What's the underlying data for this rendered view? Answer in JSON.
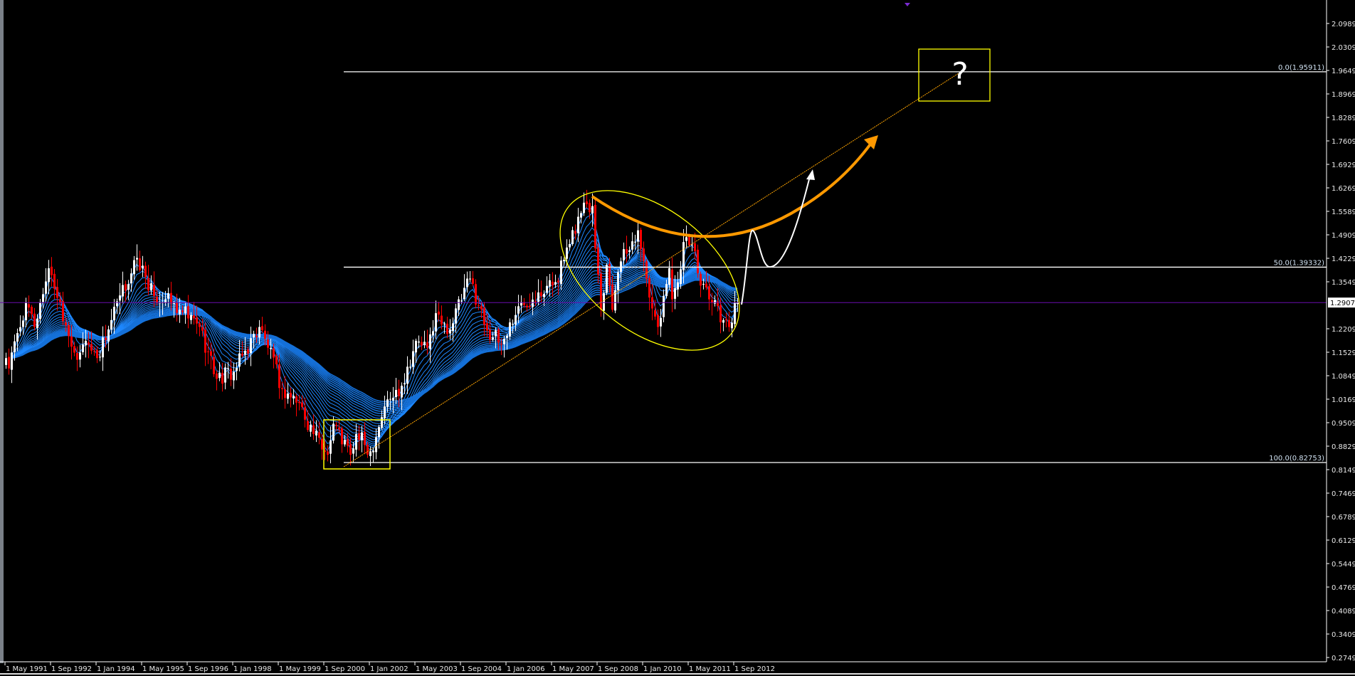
{
  "chart_data": {
    "type": "candlestick",
    "timeframe": "monthly",
    "colors": {
      "background": "#000000",
      "bull": "#ffffff",
      "bear": "#ff0000",
      "ribbon": "#1e88ff",
      "current_price_line": "#6a0dad",
      "fib": "#ffffff",
      "box": "#ffff00",
      "arc": "#ff9900",
      "trendline": "#ffa500"
    },
    "y_range": [
      0.2749,
      2.0989
    ],
    "y_ticks": [
      "2.09890",
      "2.03090",
      "1.96490",
      "1.89690",
      "1.82890",
      "1.76090",
      "1.69290",
      "1.62690",
      "1.55890",
      "1.49090",
      "1.42290",
      "1.35490",
      "",
      "1.22090",
      "1.15290",
      "1.08490",
      "1.01690",
      "0.95090",
      "0.88290",
      "0.81490",
      "0.74690",
      "0.67890",
      "0.61290",
      "0.54490",
      "0.47690",
      "0.40890",
      "0.34090",
      "0.27490"
    ],
    "x_ticks": [
      "1 May 1991",
      "1 Sep 1992",
      "1 Jan 1994",
      "1 May 1995",
      "1 Sep 1996",
      "1 Jan 1998",
      "1 May 1999",
      "1 Sep 2000",
      "1 Jan 2002",
      "1 May 2003",
      "1 Sep 2004",
      "1 Jan 2006",
      "1 May 2007",
      "1 Sep 2008",
      "1 Jan 2010",
      "1 May 2011",
      "1 Sep 2012"
    ],
    "current_price": "1.29074",
    "start_month": "1991-05",
    "bars": 258,
    "close_anchors": [
      [
        "1991-05",
        1.13
      ],
      [
        "1991-06",
        1.1
      ],
      [
        "1991-12",
        1.29
      ],
      [
        "1992-03",
        1.22
      ],
      [
        "1992-08",
        1.39
      ],
      [
        "1992-09",
        1.37
      ],
      [
        "1993-06",
        1.125
      ],
      [
        "1993-09",
        1.18
      ],
      [
        "1994-01",
        1.13
      ],
      [
        "1994-06",
        1.24
      ],
      [
        "1995-03",
        1.42
      ],
      [
        "1995-09",
        1.31
      ],
      [
        "1996-01",
        1.3
      ],
      [
        "1996-06",
        1.27
      ],
      [
        "1997-01",
        1.22
      ],
      [
        "1997-07",
        1.07
      ],
      [
        "1998-01",
        1.09
      ],
      [
        "1998-10",
        1.22
      ],
      [
        "1999-01",
        1.16
      ],
      [
        "1999-06",
        1.04
      ],
      [
        "1999-12",
        1.0
      ],
      [
        "2000-05",
        0.91
      ],
      [
        "2000-10",
        0.85
      ],
      [
        "2000-12",
        0.94
      ],
      [
        "2001-06",
        0.85
      ],
      [
        "2001-08",
        0.91
      ],
      [
        "2002-01",
        0.86
      ],
      [
        "2002-06",
        0.99
      ],
      [
        "2002-12",
        1.05
      ],
      [
        "2003-05",
        1.18
      ],
      [
        "2003-09",
        1.16
      ],
      [
        "2003-12",
        1.26
      ],
      [
        "2004-04",
        1.2
      ],
      [
        "2004-12",
        1.36
      ],
      [
        "2005-06",
        1.21
      ],
      [
        "2005-11",
        1.17
      ],
      [
        "2006-05",
        1.28
      ],
      [
        "2006-12",
        1.32
      ],
      [
        "2007-06",
        1.35
      ],
      [
        "2007-11",
        1.46
      ],
      [
        "2008-04",
        1.58
      ],
      [
        "2008-07",
        1.57
      ],
      [
        "2008-10",
        1.27
      ],
      [
        "2008-12",
        1.4
      ],
      [
        "2009-02",
        1.27
      ],
      [
        "2009-05",
        1.41
      ],
      [
        "2009-11",
        1.5
      ],
      [
        "2010-02",
        1.36
      ],
      [
        "2010-06",
        1.22
      ],
      [
        "2010-10",
        1.39
      ],
      [
        "2010-11",
        1.3
      ],
      [
        "2011-04",
        1.48
      ],
      [
        "2011-07",
        1.44
      ],
      [
        "2011-09",
        1.34
      ],
      [
        "2011-12",
        1.3
      ],
      [
        "2012-05",
        1.24
      ],
      [
        "2012-07",
        1.22
      ],
      [
        "2012-09",
        1.29
      ],
      [
        "2012-10",
        1.29
      ]
    ],
    "fibonacci": [
      {
        "level": "0.0",
        "price": 1.95911,
        "label": "0.0(1.95911)"
      },
      {
        "level": "50.0",
        "price": 1.39332,
        "label": "50.0(1.39332)"
      },
      {
        "level": "100.0",
        "price": 0.82753,
        "label": "100.0(0.82753)"
      }
    ],
    "annotations": {
      "question_text": "?"
    }
  }
}
